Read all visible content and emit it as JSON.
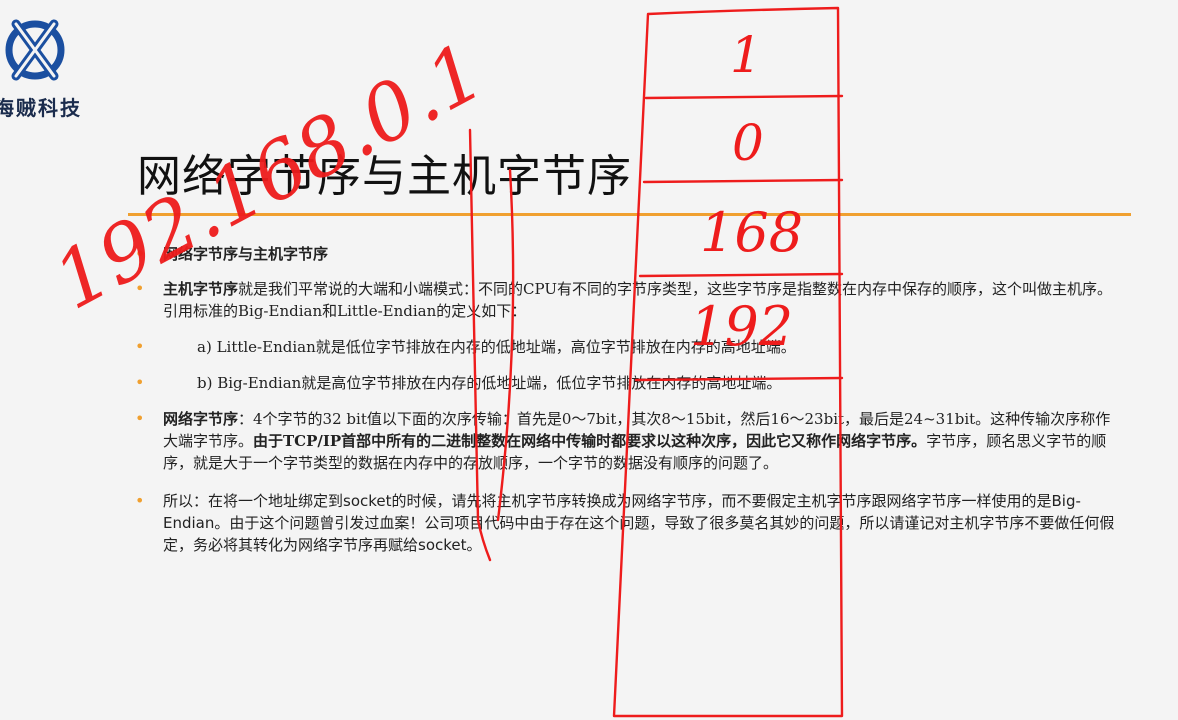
{
  "logo": {
    "text": "海贼科技"
  },
  "title": "网络字节序与主机字节序",
  "bullets": {
    "b1": "网络字节序与主机字节序",
    "b2_bold": "主机字节序",
    "b2_rest": "就是我们平常说的大端和小端模式：不同的CPU有不同的字节序类型，这些字节序是指整数在内存中保存的顺序，这个叫做主机序。引用标准的Big-Endian和Little-Endian的定义如下：",
    "b3": "a) Little-Endian就是低位字节排放在内存的低地址端，高位字节排放在内存的高地址端。",
    "b4": "b) Big-Endian就是高位字节排放在内存的低地址端，低位字节排放在内存的高地址端。",
    "b5_bold": "网络字节序",
    "b5_part1": "：4个字节的32 bit值以下面的次序传输：首先是0～7bit，其次8～15bit，然后16～23bit，最后是24~31bit。这种传输次序称作大端字节序。",
    "b5_bold2": "由于TCP/IP首部中所有的二进制整数在网络中传输时都要求以这种次序，因此它又称作网络字节序。",
    "b5_part2": "字节序，顾名思义字节的顺序，就是大于一个字节类型的数据在内存中的存放顺序，一个字节的数据没有顺序的问题了。",
    "b6": "所以：在将一个地址绑定到socket的时候，请先将主机字节序转换成为网络字节序，而不要假定主机字节序跟网络字节序一样使用的是Big-Endian。由于这个问题曾引发过血案！公司项目代码中由于存在这个问题，导致了很多莫名其妙的问题，所以请谨记对主机字节序不要做任何假定，务必将其转化为网络字节序再赋给socket。"
  },
  "annotations": {
    "ip": "192.168.0.1",
    "cells": [
      "1",
      "0",
      "168",
      "192"
    ]
  },
  "colors": {
    "accent": "#f0a030",
    "ink": "#ee1c1c",
    "logo": "#1b4fa0"
  }
}
